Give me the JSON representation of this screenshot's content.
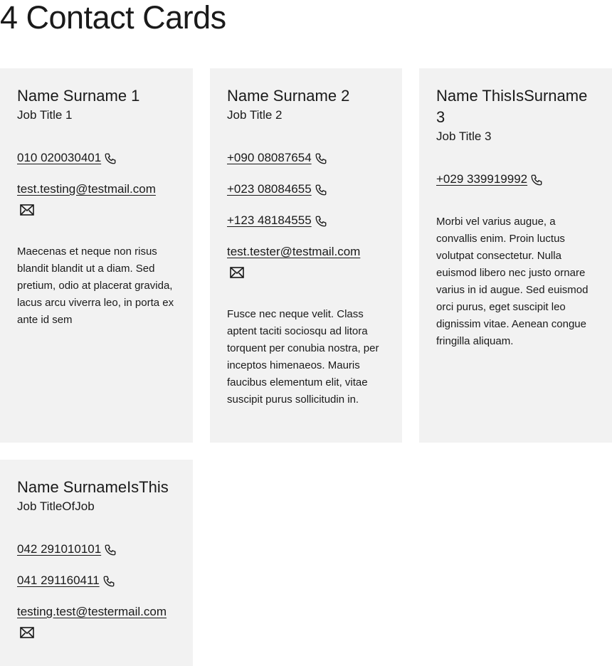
{
  "page": {
    "title": "4 Contact Cards"
  },
  "cards": [
    {
      "name": "Name Surname 1",
      "job": "Job Title 1",
      "phones": [
        "010 020030401"
      ],
      "email": "test.testing@testmail.com",
      "description": "Maecenas et neque non risus blandit blandit ut a diam. Sed pretium, odio at placerat gravida, lacus arcu viverra leo, in porta ex ante id sem"
    },
    {
      "name": "Name Surname 2",
      "job": "Job Title 2",
      "phones": [
        "+090 08087654",
        "+023 08084655",
        "+123 48184555"
      ],
      "email": "test.tester@testmail.com",
      "description": "Fusce nec neque velit. Class aptent taciti sociosqu ad litora torquent per conubia nostra, per inceptos himenaeos. Mauris faucibus elementum elit, vitae suscipit purus sollicitudin in."
    },
    {
      "name": "Name ThisIsSurname 3",
      "job": "Job Title 3",
      "phones": [
        "+029 339919992"
      ],
      "email": "",
      "description": "Morbi vel varius augue, a convallis enim. Proin luctus volutpat consectetur. Nulla euismod libero nec justo ornare varius in id augue. Sed euismod orci purus, eget suscipit leo dignissim vitae. Aenean congue fringilla aliquam."
    },
    {
      "name": "Name SurnameIsThis",
      "job": "Job TitleOfJob",
      "phones": [
        "042 291010101",
        "041 291160411"
      ],
      "email": "testing.test@testermail.com",
      "description": ""
    }
  ],
  "icons": {
    "phone": "phone-icon",
    "email": "envelope-icon"
  }
}
